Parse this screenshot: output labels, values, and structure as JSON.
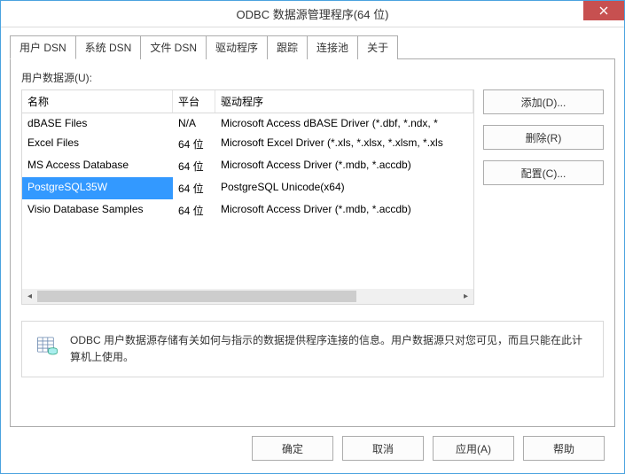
{
  "window": {
    "title": "ODBC 数据源管理程序(64 位)"
  },
  "tabs": [
    "用户 DSN",
    "系统 DSN",
    "文件 DSN",
    "驱动程序",
    "跟踪",
    "连接池",
    "关于"
  ],
  "active_tab": 0,
  "list_label": "用户数据源(U):",
  "columns": {
    "name": "名称",
    "platform": "平台",
    "driver": "驱动程序"
  },
  "rows": [
    {
      "name": "dBASE Files",
      "platform": "N/A",
      "driver": "Microsoft Access dBASE Driver (*.dbf, *.ndx, *"
    },
    {
      "name": "Excel Files",
      "platform": "64 位",
      "driver": "Microsoft Excel Driver (*.xls, *.xlsx, *.xlsm, *.xls"
    },
    {
      "name": "MS Access Database",
      "platform": "64 位",
      "driver": "Microsoft Access Driver (*.mdb, *.accdb)"
    },
    {
      "name": "PostgreSQL35W",
      "platform": "64 位",
      "driver": "PostgreSQL Unicode(x64)"
    },
    {
      "name": "Visio Database Samples",
      "platform": "64 位",
      "driver": "Microsoft Access Driver (*.mdb, *.accdb)"
    }
  ],
  "selected_row": 3,
  "side_buttons": {
    "add": "添加(D)...",
    "remove": "删除(R)",
    "configure": "配置(C)..."
  },
  "info_text": "ODBC 用户数据源存储有关如何与指示的数据提供程序连接的信息。用户数据源只对您可见，而且只能在此计算机上使用。",
  "dialog_buttons": {
    "ok": "确定",
    "cancel": "取消",
    "apply": "应用(A)",
    "help": "帮助"
  }
}
